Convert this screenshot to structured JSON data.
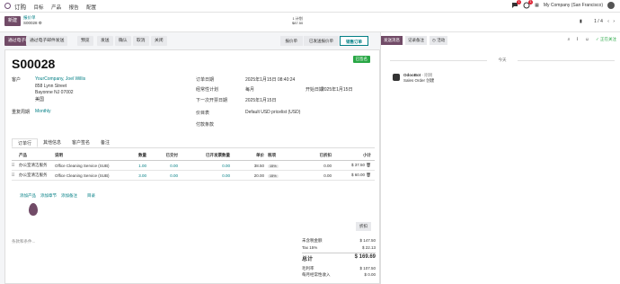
{
  "nav": {
    "menu": [
      "订购",
      "目标",
      "产品",
      "报告",
      "配置"
    ],
    "company": "My Company (San Francisco)",
    "chat_count": "1",
    "activity_count": "1"
  },
  "control": {
    "new_label": "新建",
    "breadcrumb_parent": "报价单",
    "breadcrumb_current": "S00028",
    "kpi_label": "1 计划",
    "kpi_value": "$87.50",
    "pager": "1 / 4"
  },
  "actions": {
    "send_email": "通过电子邮件发送",
    "preview": "预览",
    "send": "发送",
    "confirm": "确认",
    "cancel": "取消"
  },
  "stages": [
    "报价单",
    "已发送报价单",
    "销售订单"
  ],
  "record": {
    "name": "S00028",
    "ribbon": "已签名",
    "customer_label": "客户",
    "customer_name": "YourCompany, Joel Willis",
    "addr1": "858 Lynn Street",
    "addr2": "Bayonne NJ 07002",
    "addr3": "美国",
    "recurrence_label": "重复周期",
    "recurrence_value": "Monthly",
    "order_date_label": "订单日期",
    "order_date": "2025年1月15日 08:40:24",
    "plan_label": "经常性计划",
    "plan_value": "每月",
    "start_date_label": "开始日期",
    "start_date": "2025年1月15日",
    "next_invoice_label": "下一次开票日期",
    "next_invoice": "2025年1月15日",
    "pricelist_label": "价目表",
    "pricelist_value": "Default USD pricelist (USD)",
    "payment_label": "付款条款"
  },
  "tabs": [
    "订单行",
    "其他信息",
    "客户签名",
    "备注"
  ],
  "table": {
    "headers": [
      "产品",
      "说明",
      "数量",
      "已交付",
      "已开发票数量",
      "单价",
      "税项",
      "已折扣",
      "小计"
    ],
    "rows": [
      {
        "product": "办公室清洁服务",
        "desc": "Office Cleaning Service (SUB)",
        "qty": "1.00",
        "delivered": "0.00",
        "invoiced": "0.00",
        "price": "38.50",
        "tax": "15%",
        "disc": "0.00",
        "subtotal": "$ 37.50"
      },
      {
        "product": "办公室清洁服务",
        "desc": "Office Cleaning Service (SUB)",
        "qty": "3.00",
        "delivered": "0.00",
        "invoiced": "0.00",
        "price": "20.00",
        "tax": "15%",
        "disc": "0.00",
        "subtotal": "$ 60.00"
      }
    ],
    "add_product": "添加产品",
    "add_section": "添加章节",
    "add_note": "添加备注",
    "catalog": "目录"
  },
  "terms_placeholder": "条款和条件...",
  "discount_button": "折扣",
  "totals": {
    "untaxed_label": "未含税金额",
    "untaxed": "$ 147.50",
    "tax_label": "Tax 15%",
    "tax": "$ 22.13",
    "total_label": "总计",
    "total": "$ 169.69",
    "margin_label": "毛利率",
    "margin": "$ 107.50",
    "mrr_label": "每月经常性收入",
    "mrr": "$ 0.00"
  },
  "chatter": {
    "send_message": "发送消息",
    "log_note": "记录备注",
    "activity": "活动",
    "follow": "正在关注",
    "day": "今天",
    "author": "OdooBot",
    "time": "- 刚刚",
    "message": "Sales Order 创建"
  },
  "colors": {
    "brand": "#714b67",
    "accent": "#017e84",
    "success": "#28a745"
  }
}
